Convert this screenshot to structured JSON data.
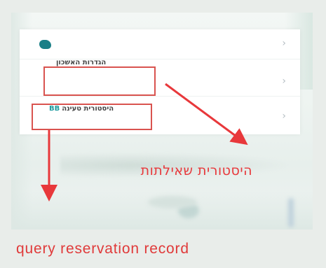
{
  "menu": {
    "items": [
      {
        "label": "",
        "icon": "app-logo-icon",
        "chevron": "›"
      },
      {
        "label": "הגדרות האשכון",
        "chevron": "›"
      },
      {
        "label": "היסטורית טעינה",
        "tag": "BB",
        "chevron": "›"
      }
    ]
  },
  "annotations": {
    "hebrew_caption": "היסטורית שאילתות",
    "english_caption": "query  reservation  record",
    "highlight_color": "#d9534f",
    "arrow_color": "#e8383b"
  }
}
